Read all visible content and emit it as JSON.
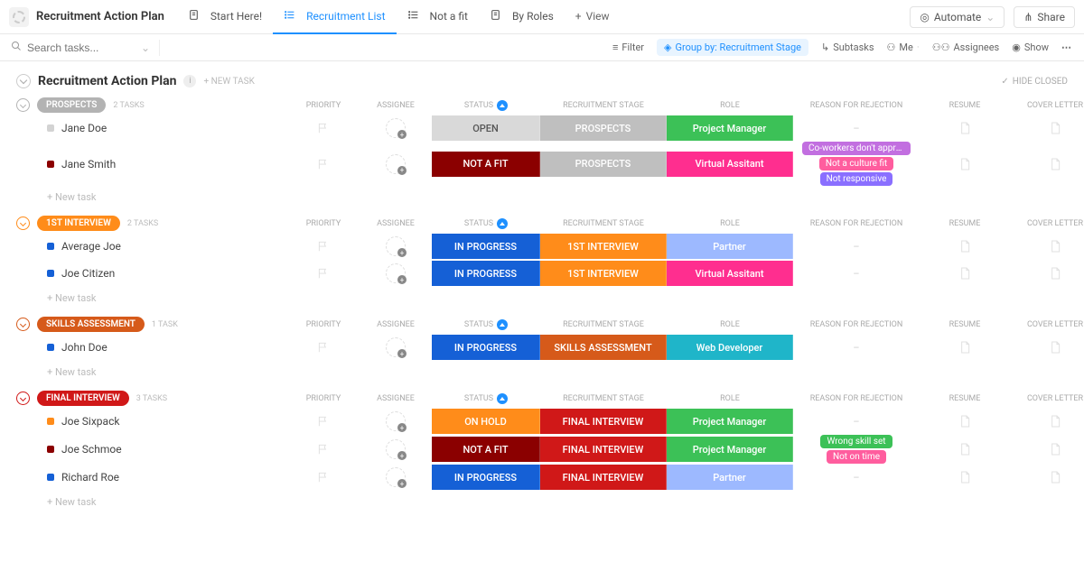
{
  "header": {
    "space_title": "Recruitment Action Plan",
    "views": [
      {
        "label": "Start Here!",
        "icon": "doc"
      },
      {
        "label": "Recruitment List",
        "icon": "list",
        "active": true
      },
      {
        "label": "Not a fit",
        "icon": "list"
      },
      {
        "label": "By Roles",
        "icon": "doc"
      }
    ],
    "add_view": "View",
    "automate": "Automate",
    "share": "Share"
  },
  "toolbar": {
    "search_placeholder": "Search tasks...",
    "filter": "Filter",
    "group_by": "Group by: Recruitment Stage",
    "subtasks": "Subtasks",
    "me": "Me",
    "assignees": "Assignees",
    "show": "Show"
  },
  "list": {
    "title": "Recruitment Action Plan",
    "new_task": "+ NEW TASK",
    "hide_closed": "HIDE CLOSED",
    "columns": {
      "priority": "PRIORITY",
      "assignee": "ASSIGNEE",
      "status": "STATUS",
      "recruitment_stage": "RECRUITMENT STAGE",
      "role": "ROLE",
      "rejection": "REASON FOR REJECTION",
      "resume": "RESUME",
      "cover": "COVER LETTER"
    },
    "new_task_row": "+ New task"
  },
  "groups": [
    {
      "name": "PROSPECTS",
      "count": "2 TASKS",
      "color": "#b3b3b3",
      "toggle_color": "#b3b3b3",
      "rows": [
        {
          "square": "#d3d3d3",
          "name": "Jane Doe",
          "status": {
            "label": "OPEN",
            "bg": "#d9d9d9",
            "fg": "#555"
          },
          "stage": {
            "label": "PROSPECTS",
            "bg": "#bfbfbf"
          },
          "role": {
            "label": "Project Manager",
            "bg": "#3cc157"
          },
          "rejection": [],
          "dash": true
        },
        {
          "square": "#8b0000",
          "name": "Jane Smith",
          "status": {
            "label": "NOT A FIT",
            "bg": "#8b0000"
          },
          "stage": {
            "label": "PROSPECTS",
            "bg": "#bfbfbf"
          },
          "role": {
            "label": "Virtual Assitant",
            "bg": "#ff2e8f"
          },
          "rejection": [
            {
              "t": "Co-workers don't appro...",
              "c": "#c26fe0"
            },
            {
              "t": "Not a culture fit",
              "c": "#ff5d9e"
            },
            {
              "t": "Not responsive",
              "c": "#8a6fff"
            }
          ]
        }
      ]
    },
    {
      "name": "1ST INTERVIEW",
      "count": "2 TASKS",
      "color": "#ff8c1a",
      "toggle_color": "#ff8c1a",
      "rows": [
        {
          "square": "#1560d6",
          "name": "Average Joe",
          "status": {
            "label": "IN PROGRESS",
            "bg": "#1560d6"
          },
          "stage": {
            "label": "1ST INTERVIEW",
            "bg": "#ff8c1a"
          },
          "role": {
            "label": "Partner",
            "bg": "#9db9ff"
          },
          "rejection": [],
          "dash": true
        },
        {
          "square": "#1560d6",
          "name": "Joe Citizen",
          "status": {
            "label": "IN PROGRESS",
            "bg": "#1560d6"
          },
          "stage": {
            "label": "1ST INTERVIEW",
            "bg": "#ff8c1a"
          },
          "role": {
            "label": "Virtual Assitant",
            "bg": "#ff2e8f"
          },
          "rejection": [],
          "dash": true
        }
      ]
    },
    {
      "name": "SKILLS ASSESSMENT",
      "count": "1 TASK",
      "color": "#d65a1a",
      "toggle_color": "#d65a1a",
      "rows": [
        {
          "square": "#1560d6",
          "name": "John Doe",
          "status": {
            "label": "IN PROGRESS",
            "bg": "#1560d6"
          },
          "stage": {
            "label": "SKILLS ASSESSMENT",
            "bg": "#d65a1a"
          },
          "role": {
            "label": "Web Developer",
            "bg": "#1fb5c9"
          },
          "rejection": [],
          "dash": true
        }
      ]
    },
    {
      "name": "FINAL INTERVIEW",
      "count": "3 TASKS",
      "color": "#d01818",
      "toggle_color": "#d01818",
      "rows": [
        {
          "square": "#ff8c1a",
          "name": "Joe Sixpack",
          "status": {
            "label": "ON HOLD",
            "bg": "#ff8c1a"
          },
          "stage": {
            "label": "FINAL INTERVIEW",
            "bg": "#d01818"
          },
          "role": {
            "label": "Project Manager",
            "bg": "#3cc157"
          },
          "rejection": [],
          "dash": true
        },
        {
          "square": "#8b0000",
          "name": "Joe Schmoe",
          "status": {
            "label": "NOT A FIT",
            "bg": "#8b0000"
          },
          "stage": {
            "label": "FINAL INTERVIEW",
            "bg": "#d01818"
          },
          "role": {
            "label": "Project Manager",
            "bg": "#3cc157"
          },
          "rejection": [
            {
              "t": "Wrong skill set",
              "c": "#3cc157"
            },
            {
              "t": "Not on time",
              "c": "#ff5d9e"
            }
          ]
        },
        {
          "square": "#1560d6",
          "name": "Richard Roe",
          "status": {
            "label": "IN PROGRESS",
            "bg": "#1560d6"
          },
          "stage": {
            "label": "FINAL INTERVIEW",
            "bg": "#d01818"
          },
          "role": {
            "label": "Partner",
            "bg": "#9db9ff"
          },
          "rejection": [],
          "dash": true
        }
      ]
    }
  ]
}
